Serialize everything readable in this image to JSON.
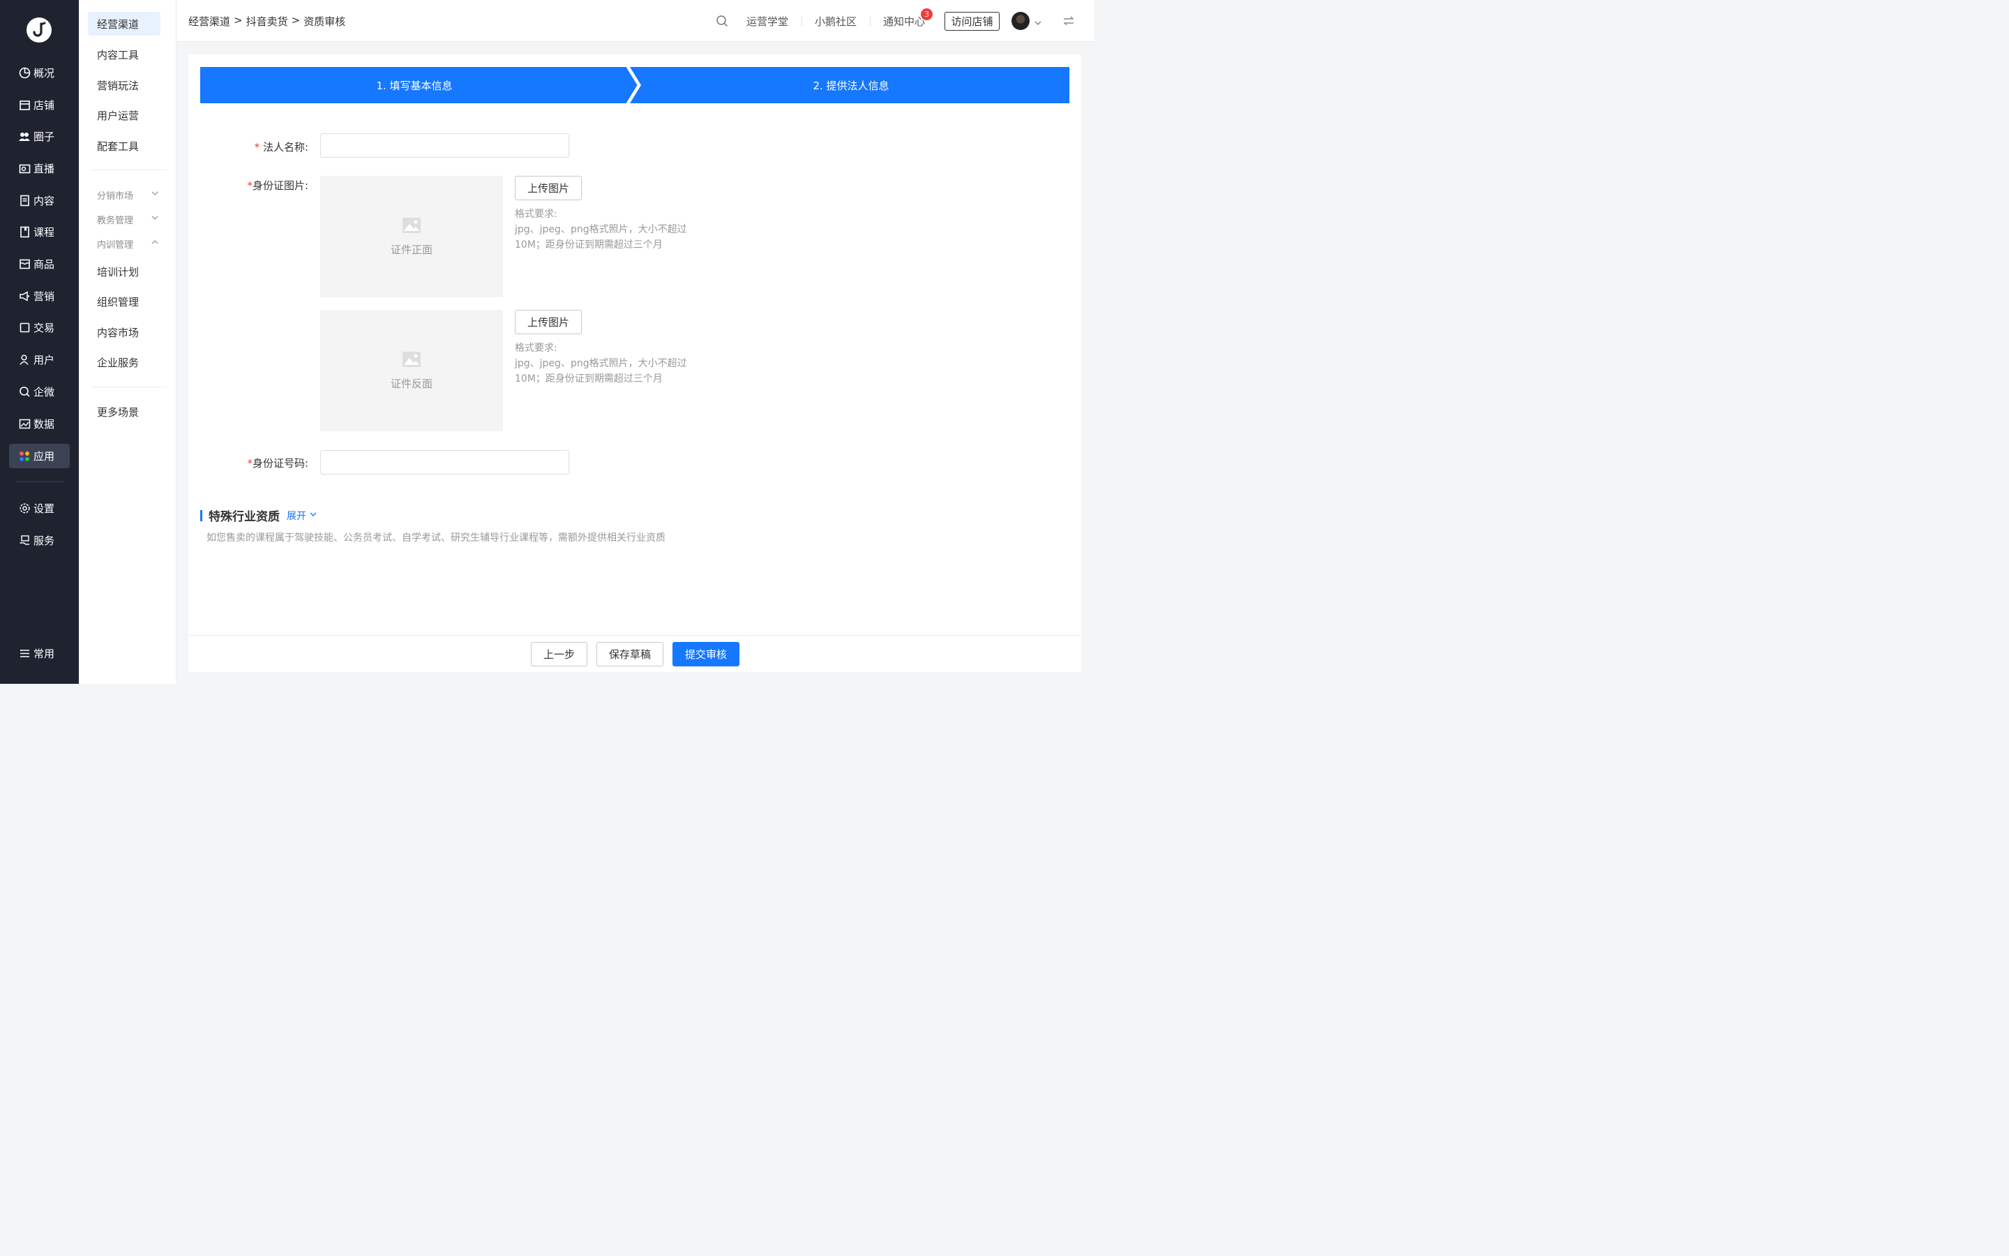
{
  "nav": {
    "items": [
      {
        "label": "概况",
        "icon": "pie-chart-icon"
      },
      {
        "label": "店铺",
        "icon": "store-icon"
      },
      {
        "label": "圈子",
        "icon": "group-icon"
      },
      {
        "label": "直播",
        "icon": "live-camera-icon"
      },
      {
        "label": "内容",
        "icon": "document-icon"
      },
      {
        "label": "课程",
        "icon": "book-icon"
      },
      {
        "label": "商品",
        "icon": "inbox-icon"
      },
      {
        "label": "营销",
        "icon": "megaphone-icon"
      },
      {
        "label": "交易",
        "icon": "square-icon"
      },
      {
        "label": "用户",
        "icon": "user-icon"
      },
      {
        "label": "企微",
        "icon": "chat-search-icon"
      },
      {
        "label": "数据",
        "icon": "image-chart-icon"
      },
      {
        "label": "应用",
        "icon": "apps-icon"
      }
    ],
    "settings": "设置",
    "service": "服务",
    "common": "常用",
    "active": "应用"
  },
  "submenu": {
    "top": [
      "经营渠道",
      "内容工具",
      "营销玩法",
      "用户运营",
      "配套工具"
    ],
    "groups": [
      {
        "label": "分销市场",
        "expanded": false
      },
      {
        "label": "教务管理",
        "expanded": false
      },
      {
        "label": "内训管理",
        "expanded": true
      }
    ],
    "inner": [
      "培训计划",
      "组织管理",
      "内容市场",
      "企业服务"
    ],
    "more": "更多场景",
    "active": "经营渠道"
  },
  "header": {
    "breadcrumb": [
      "经营渠道",
      ">",
      "抖音卖货",
      ">",
      "资质审核"
    ],
    "links": [
      "运营学堂",
      "小鹅社区",
      "通知中心"
    ],
    "notify_count": "3",
    "visit_store": "访问店铺"
  },
  "steps": {
    "step1": "1. 填写基本信息",
    "step2": "2. 提供法人信息",
    "color": "#1677ff"
  },
  "form": {
    "legal_name_label": "法人名称:",
    "legal_name_value": "",
    "id_image_label": "身份证图片:",
    "front_caption": "证件正面",
    "back_caption": "证件反面",
    "upload_button": "上传图片",
    "hint_title": "格式要求:",
    "hint_line1": "jpg、jpeg、png格式照片，大小不超过",
    "hint_line2": "10M；距身份证到期需超过三个月",
    "id_number_label": "身份证号码:",
    "id_number_value": "",
    "required_mark": "*"
  },
  "special": {
    "title": "特殊行业资质",
    "expand": "展开",
    "desc": "如您售卖的课程属于驾驶技能、公务员考试、自学考试、研究生辅导行业课程等，需额外提供相关行业资质"
  },
  "footer": {
    "prev": "上一步",
    "save": "保存草稿",
    "submit": "提交审核"
  }
}
